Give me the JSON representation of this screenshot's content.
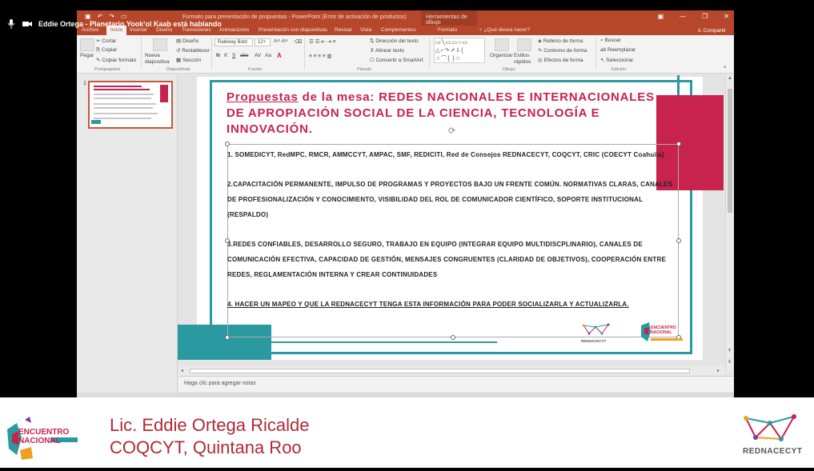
{
  "meeting": {
    "speaking_status": "Eddie Ortega - Planetario Yook'ol Kaab está hablando"
  },
  "app": {
    "window_title": "Formato para presentación de propuestas - PowerPoint (Error de activación de productos)",
    "contextual_tab": "Herramientas de dibujo",
    "tabs": [
      "Archivo",
      "Inicio",
      "Insertar",
      "Diseño",
      "Transiciones",
      "Animaciones",
      "Presentación con diapositivas",
      "Revisar",
      "Vista",
      "Complementos",
      "Formato"
    ],
    "active_tab": "Inicio",
    "tell_me": "¿Qué desea hacer?",
    "share": "Compartir"
  },
  "ribbon": {
    "clipboard": {
      "paste": "Pegar",
      "cut": "Cortar",
      "copy": "Copiar",
      "format_painter": "Copiar formato",
      "group": "Portapapeles"
    },
    "slides": {
      "new_slide": "Nueva diapositiva",
      "layout": "Diseño",
      "reset": "Restablecer",
      "section": "Sección",
      "group": "Diapositivas"
    },
    "font": {
      "font_name": "Raleway Bold",
      "font_size": "12+",
      "group": "Fuente"
    },
    "paragraph": {
      "text_direction": "Dirección del texto",
      "align_text": "Alinear texto",
      "smartart": "Convertir a SmartArt",
      "group": "Párrafo"
    },
    "drawing": {
      "arrange": "Organizar",
      "quick_styles": "Estilos rápidos",
      "fill": "Relleno de forma",
      "outline": "Contorno de forma",
      "effects": "Efectos de forma",
      "group": "Dibujo"
    },
    "editing": {
      "find": "Buscar",
      "replace": "Reemplazar",
      "select": "Seleccionar",
      "group": "Edición"
    }
  },
  "thumbnails": {
    "slide_number": "1"
  },
  "slide": {
    "title_prefix": "Propuestas",
    "title_rest": " de la mesa: REDES NACIONALES E INTERNACIONALES DE APROPIACIÓN SOCIAL DE LA CIENCIA, TECNOLOGÍA E INNOVACIÓN.",
    "p1": "1. SOMEDICYT, RedMPC, RMCR, AMMCCYT, AMPAC, SMF, REDICITI, Red de Consejos REDNACECYT, COQCYT, CRIC (COECYT Coahuila)",
    "p2": "2.CAPACITACIÓN PERMANENTE, IMPULSO DE PROGRAMAS Y PROYECTOS BAJO UN FRENTE COMÚN. NORMATIVAS CLARAS, CANALES DE PROFESIONALIZACIÓN Y CONOCIMIENTO, VISIBILIDAD DEL ROL DE COMUNICADOR CIENTÍFICO, SOPORTE INSTITUCIONAL (RESPALDO)",
    "p3": "3.REDES CONFIABLES, DESARROLLO SEGURO, TRABAJO EN EQUIPO (INTEGRAR EQUIPO MULTIDISCPLINARIO), CANALES DE COMUNICACIÓN EFECTIVA, CAPACIDAD DE GESTIÓN, MENSAJES CONGRUENTES (CLARIDAD DE OBJETIVOS), COOPERACIÓN ENTRE REDES, REGLAMENTACIÓN INTERNA Y CREAR CONTINUIDADES",
    "p4": "4. HACER UN MAPEO Y QUE LA REDNACECYT TENGA ESTA INFORMACIÓN PARA PODER SOCIALIZARLA Y ACTUALIZARLA.",
    "logo_rednacecyt": "REDNACECYT",
    "logo_encuentro": "ENCUENTRO NACIONAL"
  },
  "notes_placeholder": "Haga clic para agregar notas",
  "banner": {
    "speaker_name": "Lic. Eddie Ortega Ricalde",
    "speaker_org": "COQCYT, Quintana Roo",
    "left_logo_line1": "ENCUENTRO",
    "left_logo_line2": "NACIONAL",
    "right_logo_text": "REDNACECYT"
  },
  "colors": {
    "ppt_accent": "#b7472a",
    "slide_magenta": "#c8224f",
    "slide_teal": "#2b9aa0",
    "banner_text": "#b02a37"
  }
}
